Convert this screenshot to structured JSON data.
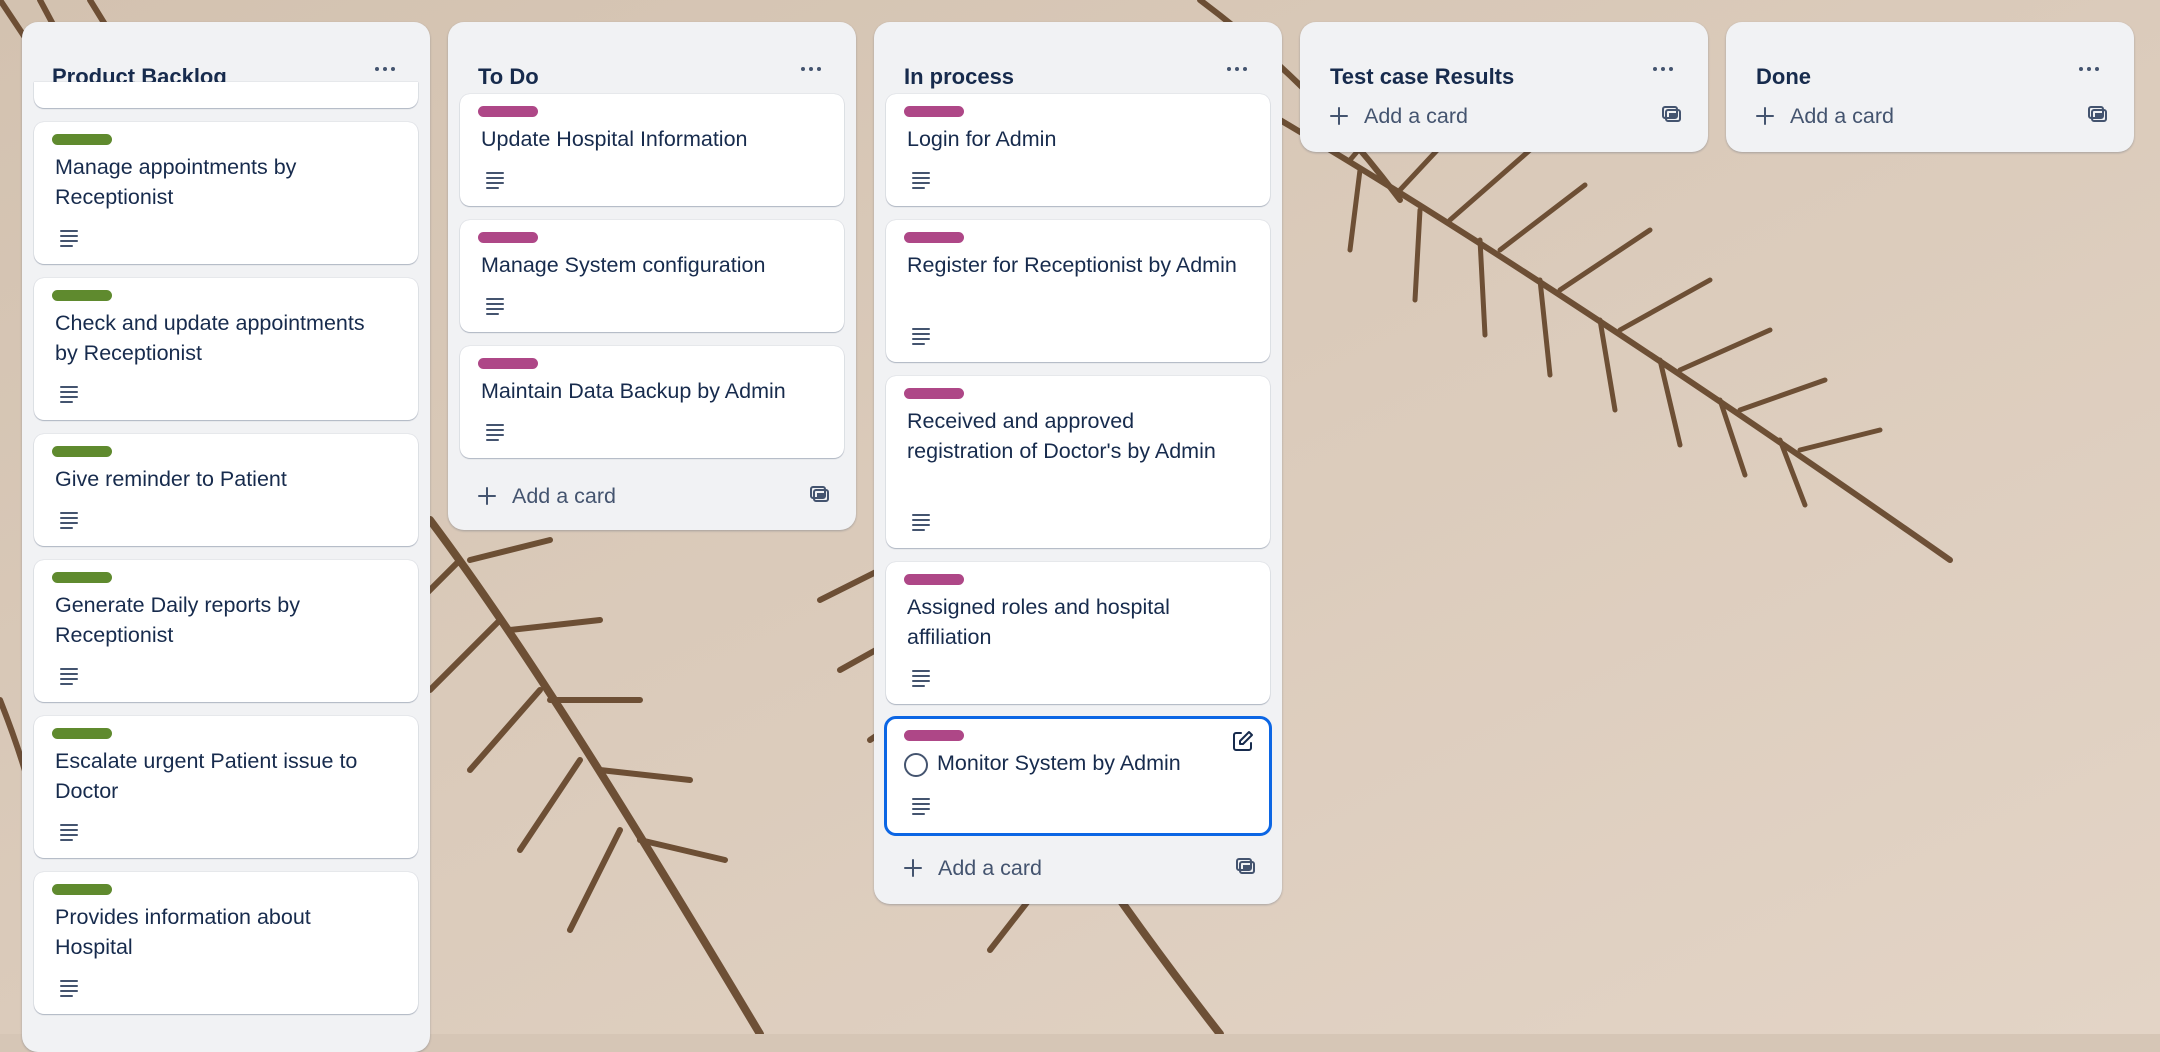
{
  "board": {
    "lists": [
      {
        "title": "Product Backlog",
        "cards": [
          {
            "title": "Manage appointments by Receptionist",
            "label_color": "green"
          },
          {
            "title": "Check and update appointments by Receptionist",
            "label_color": "green"
          },
          {
            "title": "Give reminder to Patient",
            "label_color": "green"
          },
          {
            "title": "Generate Daily reports by Receptionist",
            "label_color": "green"
          },
          {
            "title": "Escalate urgent Patient issue to Doctor",
            "label_color": "green"
          },
          {
            "title": "Provides information about Hospital",
            "label_color": "green"
          }
        ]
      },
      {
        "title": "To Do",
        "cards": [
          {
            "title": "Update Hospital Information",
            "label_color": "pink"
          },
          {
            "title": "Manage System configuration",
            "label_color": "pink"
          },
          {
            "title": "Maintain Data Backup by Admin",
            "label_color": "pink"
          }
        ],
        "add_card_label": "Add a card"
      },
      {
        "title": "In process",
        "cards": [
          {
            "title": "Login for Admin",
            "label_color": "pink"
          },
          {
            "title": "Register for Receptionist by Admin",
            "label_color": "pink"
          },
          {
            "title": "Received and approved registration of Doctor's by Admin",
            "label_color": "pink"
          },
          {
            "title": "Assigned roles and hospital affiliation",
            "label_color": "pink"
          },
          {
            "title": "Monitor System by Admin",
            "label_color": "pink",
            "hovered": true
          }
        ],
        "add_card_label": "Add a card"
      },
      {
        "title": "Test case Results",
        "cards": [],
        "add_card_label": "Add a card"
      },
      {
        "title": "Done",
        "cards": [],
        "add_card_label": "Add a card"
      }
    ]
  },
  "colors": {
    "label_green": "#5f8a2e",
    "label_pink": "#ae4787",
    "list_bg": "#f1f2f4",
    "focus_outline": "#0c66e4"
  },
  "icons": [
    "more-horizontal-icon",
    "description-icon",
    "plus-icon",
    "card-template-icon",
    "edit-icon",
    "checkbox-circle-icon"
  ]
}
